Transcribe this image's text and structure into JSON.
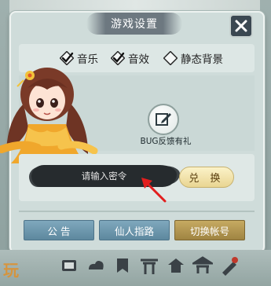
{
  "dialog": {
    "title": "游戏设置"
  },
  "options": [
    {
      "label": "音乐",
      "checked": true
    },
    {
      "label": "音效",
      "checked": true
    },
    {
      "label": "静态背景",
      "checked": false
    }
  ],
  "bug_report": {
    "label": "BUG反馈有礼"
  },
  "redeem": {
    "placeholder": "请输入密令",
    "button_label": "兑 换"
  },
  "buttons": {
    "announcement": "公 告",
    "guide": "仙人指路",
    "switch_account": "切换帐号"
  },
  "watermark": "玩",
  "colors": {
    "gold_button": "#b39a52",
    "blue_button": "#6f98ae",
    "arrow": "#e21e1e"
  }
}
